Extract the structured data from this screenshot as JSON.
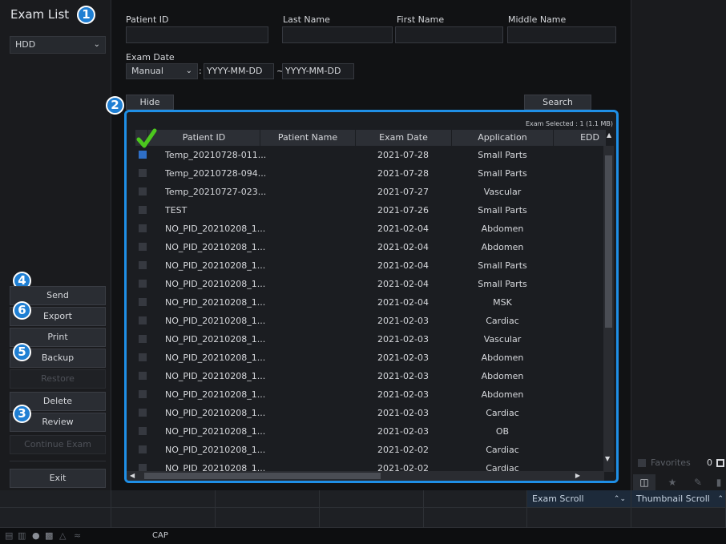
{
  "left_panel": {
    "title": "Exam List",
    "storage": {
      "selected": "HDD"
    },
    "buttons": {
      "send": "Send",
      "export": "Export",
      "print": "Print",
      "backup": "Backup",
      "restore": "Restore",
      "delete": "Delete",
      "review": "Review",
      "continue_exam": "Continue Exam",
      "exit": "Exit"
    }
  },
  "badges": {
    "b1": "1",
    "b2": "2",
    "b3": "3",
    "b4": "4",
    "b5": "5",
    "b6": "6"
  },
  "search_form": {
    "patient_id_label": "Patient ID",
    "last_name_label": "Last Name",
    "first_name_label": "First Name",
    "middle_name_label": "Middle Name",
    "exam_date_label": "Exam Date",
    "date_mode": "Manual",
    "colon": ":",
    "date_from_placeholder": "YYYY-MM-DD",
    "tilde": "~",
    "date_to_placeholder": "YYYY-MM-DD",
    "hide_label": "Hide",
    "search_label": "Search"
  },
  "exam_table": {
    "selected_info": "Exam Selected : 1 (1.1 MB)",
    "columns": [
      "Patient ID",
      "Patient Name",
      "Exam Date",
      "Application",
      "EDD"
    ],
    "rows": [
      {
        "pid": "Temp_20210728-011...",
        "name": "",
        "date": "2021-07-28",
        "app": "Small Parts",
        "checked": true
      },
      {
        "pid": "Temp_20210728-094...",
        "name": "",
        "date": "2021-07-28",
        "app": "Small Parts",
        "checked": false
      },
      {
        "pid": "Temp_20210727-023...",
        "name": "",
        "date": "2021-07-27",
        "app": "Vascular",
        "checked": false
      },
      {
        "pid": "TEST",
        "name": "",
        "date": "2021-07-26",
        "app": "Small Parts",
        "checked": false
      },
      {
        "pid": "NO_PID_20210208_1...",
        "name": "",
        "date": "2021-02-04",
        "app": "Abdomen",
        "checked": false
      },
      {
        "pid": "NO_PID_20210208_1...",
        "name": "",
        "date": "2021-02-04",
        "app": "Abdomen",
        "checked": false
      },
      {
        "pid": "NO_PID_20210208_1...",
        "name": "",
        "date": "2021-02-04",
        "app": "Small Parts",
        "checked": false
      },
      {
        "pid": "NO_PID_20210208_1...",
        "name": "",
        "date": "2021-02-04",
        "app": "Small Parts",
        "checked": false
      },
      {
        "pid": "NO_PID_20210208_1...",
        "name": "",
        "date": "2021-02-04",
        "app": "MSK",
        "checked": false
      },
      {
        "pid": "NO_PID_20210208_1...",
        "name": "",
        "date": "2021-02-03",
        "app": "Cardiac",
        "checked": false
      },
      {
        "pid": "NO_PID_20210208_1...",
        "name": "",
        "date": "2021-02-03",
        "app": "Vascular",
        "checked": false
      },
      {
        "pid": "NO_PID_20210208_1...",
        "name": "",
        "date": "2021-02-03",
        "app": "Abdomen",
        "checked": false
      },
      {
        "pid": "NO_PID_20210208_1...",
        "name": "",
        "date": "2021-02-03",
        "app": "Abdomen",
        "checked": false
      },
      {
        "pid": "NO_PID_20210208_1...",
        "name": "",
        "date": "2021-02-03",
        "app": "Abdomen",
        "checked": false
      },
      {
        "pid": "NO_PID_20210208_1...",
        "name": "",
        "date": "2021-02-03",
        "app": "Cardiac",
        "checked": false
      },
      {
        "pid": "NO_PID_20210208_1...",
        "name": "",
        "date": "2021-02-03",
        "app": "OB",
        "checked": false
      },
      {
        "pid": "NO_PID_20210208_1...",
        "name": "",
        "date": "2021-02-02",
        "app": "Cardiac",
        "checked": false
      },
      {
        "pid": "NO_PID_20210208_1...",
        "name": "",
        "date": "2021-02-02",
        "app": "Cardiac",
        "checked": false
      }
    ]
  },
  "thumbnail_panel": {
    "favorites_label": "Favorites",
    "favorites_count": "0"
  },
  "bottom_bar": {
    "exam_scroll": "Exam Scroll",
    "thumbnail_scroll": "Thumbnail Scroll",
    "caps": "CAP"
  },
  "colors": {
    "accent": "#1f8fe6",
    "badge": "#1f7fd3",
    "check": "#4cc81e"
  }
}
